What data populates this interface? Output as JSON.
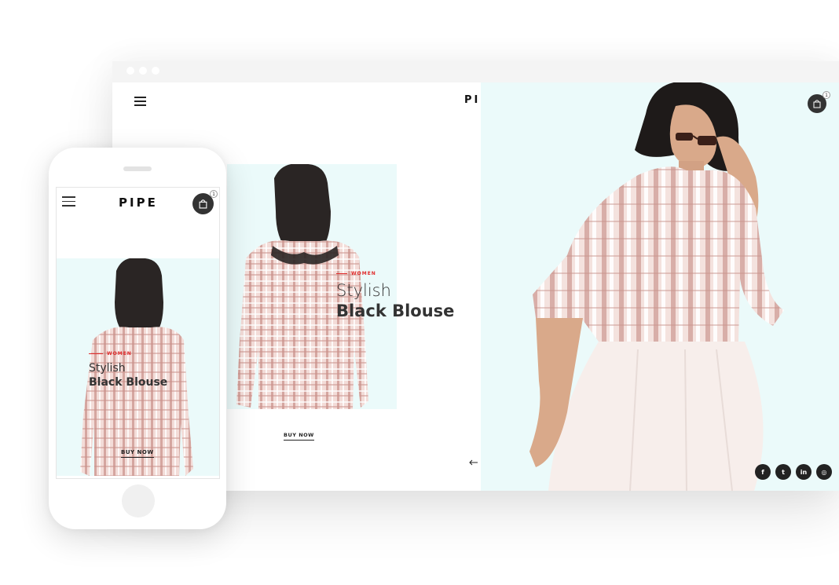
{
  "desktop": {
    "brand": "PIPE",
    "category": "WOMEN",
    "subtitle": "Stylish",
    "title": "Black Blouse",
    "buy_label": "BUY NOW",
    "cart_count": "1",
    "social": [
      {
        "icon": "facebook-icon",
        "glyph": "f"
      },
      {
        "icon": "twitter-icon",
        "glyph": "t"
      },
      {
        "icon": "linkedin-icon",
        "glyph": "in"
      },
      {
        "icon": "instagram-icon",
        "glyph": "◎"
      }
    ]
  },
  "mobile": {
    "brand": "PIPE",
    "category": "WOMEN",
    "subtitle": "Stylish",
    "title": "Black Blouse",
    "buy_label": "BUY NOW",
    "cart_count": "1"
  },
  "colors": {
    "accent": "#e02b2b",
    "hero_bg": "#ebfafa",
    "text": "#333333"
  }
}
